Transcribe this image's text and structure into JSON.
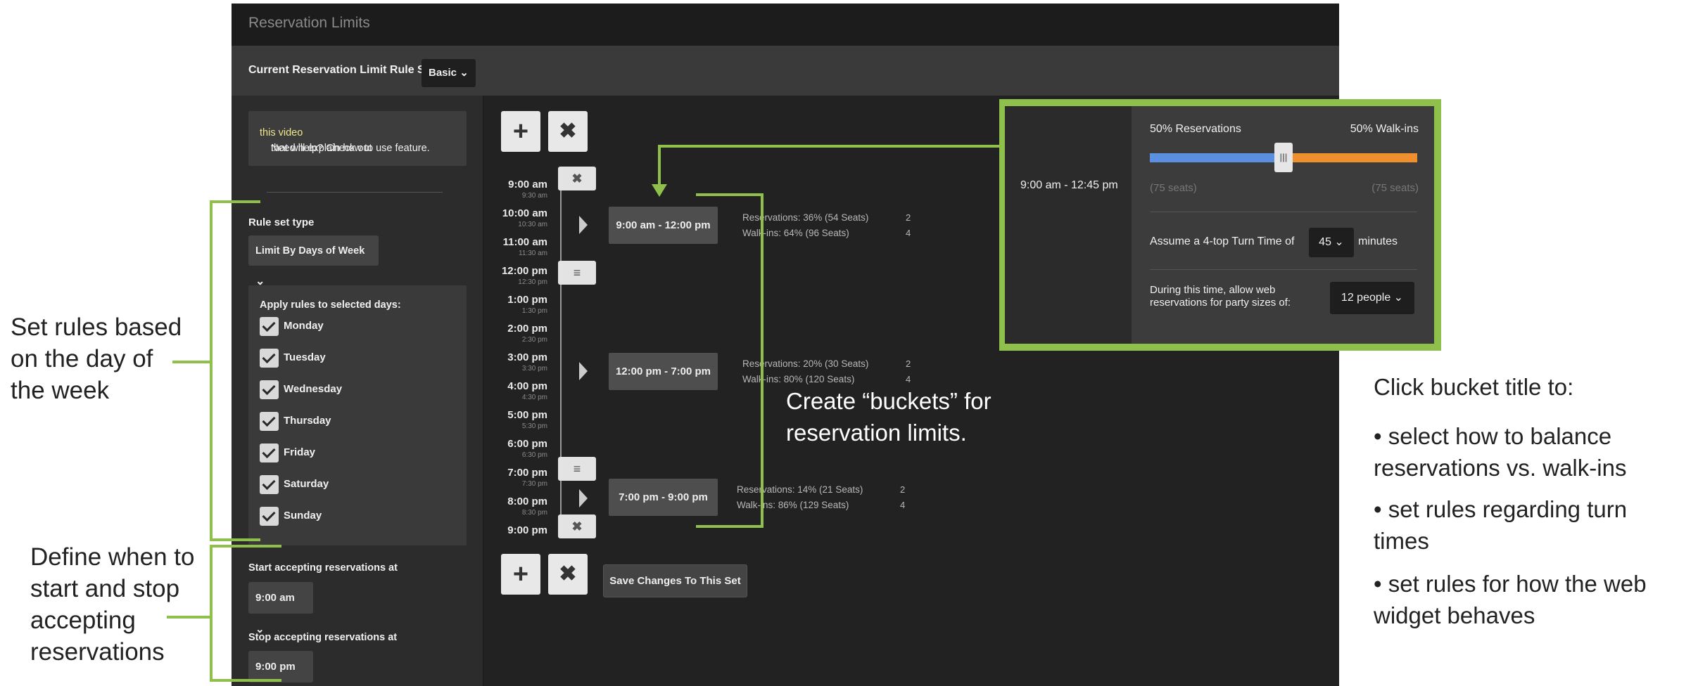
{
  "window": {
    "title": "Reservation Limits"
  },
  "rule_set": {
    "label": "Current Reservation Limit Rule Set",
    "value": "Basic"
  },
  "help": {
    "prefix": "Need help? Check out ",
    "link": "this video",
    "suffix": " that will explain how to use feature."
  },
  "rule_type": {
    "label": "Rule set type",
    "value": "Limit By Days of Week"
  },
  "days": {
    "heading": "Apply rules to selected days:",
    "items": [
      {
        "label": "Monday",
        "checked": true
      },
      {
        "label": "Tuesday",
        "checked": true
      },
      {
        "label": "Wednesday",
        "checked": true
      },
      {
        "label": "Thursday",
        "checked": true
      },
      {
        "label": "Friday",
        "checked": true
      },
      {
        "label": "Saturday",
        "checked": true
      },
      {
        "label": "Sunday",
        "checked": true
      }
    ]
  },
  "start": {
    "label": "Start accepting reservations at",
    "value": "9:00 am"
  },
  "stop": {
    "label": "Stop accepting reservations at",
    "value": "9:00 pm"
  },
  "timeline": {
    "hours": [
      "9:00 am",
      "10:00 am",
      "11:00 am",
      "12:00 pm",
      "1:00 pm",
      "2:00 pm",
      "3:00 pm",
      "4:00 pm",
      "5:00 pm",
      "6:00 pm",
      "7:00 pm",
      "8:00 pm",
      "9:00 pm"
    ],
    "halves": [
      "9:30 am",
      "10:30 am",
      "11:30 am",
      "12:30 pm",
      "1:30 pm",
      "2:30 pm",
      "3:30 pm",
      "4:30 pm",
      "5:30 pm",
      "6:30 pm",
      "7:30 pm",
      "8:30 pm"
    ]
  },
  "buckets": [
    {
      "title": "9:00 am - 12:00 pm",
      "reservations": "Reservations: 36% (54 Seats)",
      "walkins": "Walk-ins: 64% (96 Seats)",
      "n1": "2",
      "n2": "4"
    },
    {
      "title": "12:00 pm - 7:00 pm",
      "reservations": "Reservations: 20% (30 Seats)",
      "walkins": "Walk-ins: 80% (120 Seats)",
      "n1": "2",
      "n2": "4"
    },
    {
      "title": "7:00 pm - 9:00 pm",
      "reservations": "Reservations: 14% (21 Seats)",
      "walkins": "Walk-ins: 86% (129 Seats)",
      "n1": "2",
      "n2": "4"
    }
  ],
  "save_label": "Save Changes To This Set",
  "popup": {
    "bucket": "9:00 am - 12:45 pm",
    "reservations_label": "50% Reservations",
    "walkins_label": "50% Walk-ins",
    "reservation_share": 0.5,
    "res_seats": "(75 seats)",
    "walk_seats": "(75 seats)",
    "turn_prefix": "Assume a 4-top Turn Time of",
    "turn_value": "45",
    "turn_suffix": "minutes",
    "party_text": "During this time, allow web reservations for party sizes of:",
    "party_value": "12 people"
  },
  "annotations": {
    "days": [
      "Set rules based",
      "on the day of",
      "the week"
    ],
    "start_stop": [
      "Define when to",
      "start and stop",
      "accepting",
      "reservations"
    ],
    "buckets": [
      "Create “buckets” for",
      "reservation limits."
    ],
    "click_title": "Click bucket title to:",
    "bullets": [
      [
        "• select how to balance",
        "reservations vs. walk-ins"
      ],
      [
        "• set rules regarding turn",
        "times"
      ],
      [
        "• set rules for how the web",
        "widget behaves"
      ]
    ]
  },
  "colors": {
    "accent_green": "#90c04c",
    "reservation_bar": "#5b8fe0",
    "walkin_bar": "#ef8f2e"
  }
}
